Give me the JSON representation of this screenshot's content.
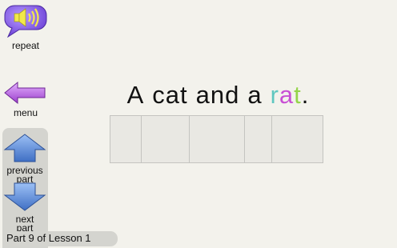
{
  "controls": {
    "repeat_label": "repeat",
    "menu_label": "menu",
    "previous_line1": "previous",
    "previous_line2": "part",
    "next_line1": "next",
    "next_line2": "part"
  },
  "status": {
    "part_text": "Part 9 of Lesson 1"
  },
  "sentence": {
    "w1": "A",
    "w2": "cat",
    "w3": "and",
    "w4": "a",
    "last_word_letters": [
      "r",
      "a",
      "t"
    ],
    "end_punct": "."
  },
  "colors": {
    "letter_r": "#5fc7c0",
    "letter_a": "#c84fd4",
    "letter_t": "#94d44a",
    "speaker_bubble": "#8b5cf6",
    "menu_arrow": "#b25fe0",
    "nav_arrows": "#6a93d6"
  },
  "icons": {
    "repeat": "speaker-icon",
    "menu": "left-arrow-icon",
    "previous": "up-arrow-icon",
    "next": "down-arrow-icon"
  }
}
